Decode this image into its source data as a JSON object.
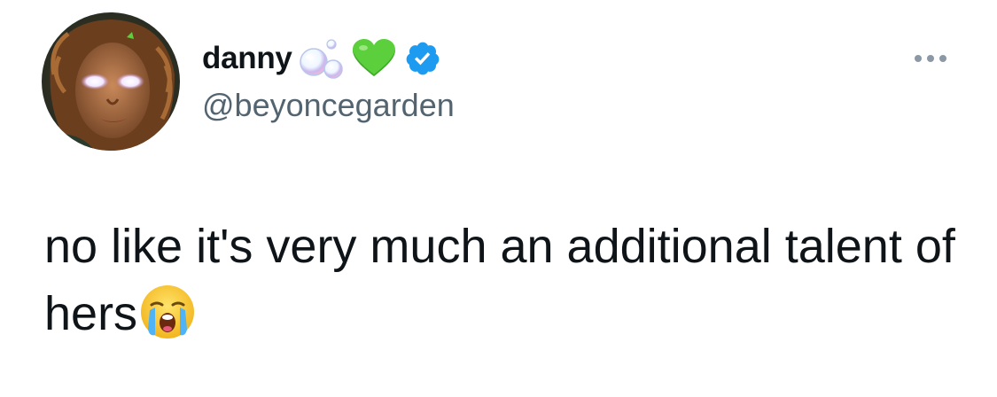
{
  "tweet": {
    "display_name": "danny",
    "name_emojis": [
      "bubbles-emoji",
      "green-heart-emoji"
    ],
    "verified": true,
    "handle": "@beyoncegarden",
    "text": "no like it's very much an additional talent of hers",
    "trailing_emoji": "loudly-crying-face-emoji"
  },
  "icons": {
    "more": "more-options-icon",
    "verified": "verified-badge-icon"
  },
  "colors": {
    "verified_blue": "#1d9bf0",
    "handle_gray": "#536471",
    "text": "#0f1419",
    "heart_green": "#5ccf3c"
  }
}
